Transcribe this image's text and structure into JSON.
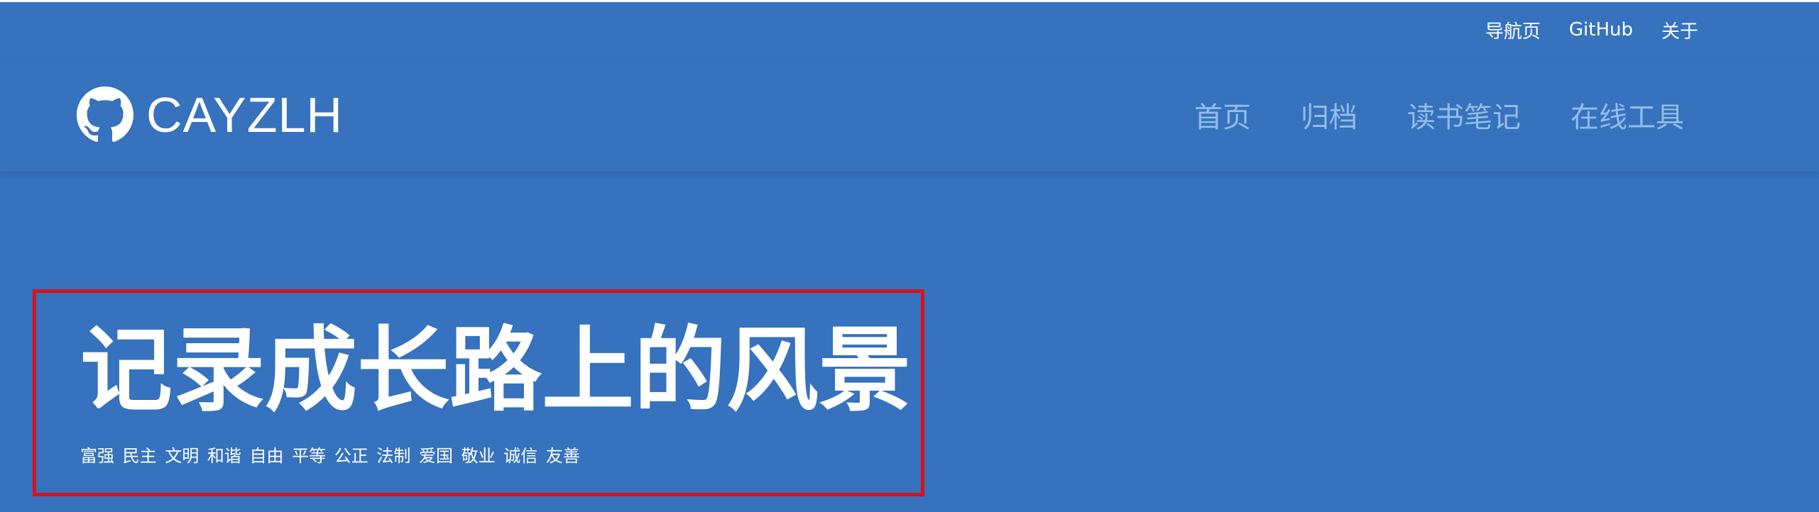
{
  "topbar": {
    "links": [
      {
        "label": "导航页"
      },
      {
        "label": "GitHub"
      },
      {
        "label": "关于"
      }
    ]
  },
  "header": {
    "brand": {
      "name": "CAYZLH",
      "icon": "github-icon"
    },
    "nav": [
      {
        "label": "首页"
      },
      {
        "label": "归档"
      },
      {
        "label": "读书笔记"
      },
      {
        "label": "在线工具"
      }
    ]
  },
  "hero": {
    "title": "记录成长路上的风景",
    "subtitle": "富强 民主 文明 和谐 自由 平等 公正 法制 爱国 敬业 诚信 友善"
  },
  "colors": {
    "background": "#3672bd",
    "nav_text": "#93bde8",
    "highlight_border": "#d8121b",
    "text": "#ffffff"
  }
}
